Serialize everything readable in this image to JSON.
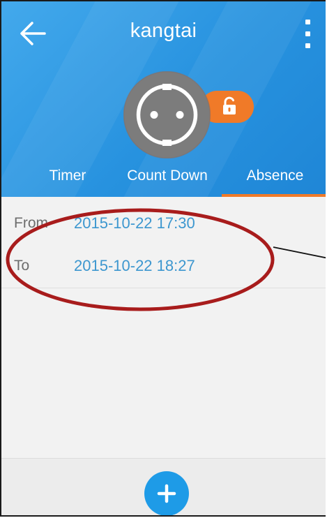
{
  "header": {
    "title": "kangtai",
    "back_icon": "back-arrow-icon",
    "menu_icon": "overflow-menu-icon",
    "gradient_start": "#43a9ec",
    "gradient_end": "#1f86d6"
  },
  "device": {
    "icon": "power-socket-icon",
    "lock_icon": "unlocked-padlock-icon",
    "lock_badge_color": "#f07a28"
  },
  "tabs": [
    {
      "label": "Timer",
      "active": false
    },
    {
      "label": "Count Down",
      "active": false
    },
    {
      "label": "Absence",
      "active": true
    }
  ],
  "absence": {
    "from_label": "From",
    "from_value": "2015-10-22 17:30",
    "to_label": "To",
    "to_value": "2015-10-22 18:27"
  },
  "bottom": {
    "add_icon": "plus-icon",
    "add_color": "#1e9be7"
  },
  "annotation": {
    "ellipse_color": "#a81c1c"
  }
}
